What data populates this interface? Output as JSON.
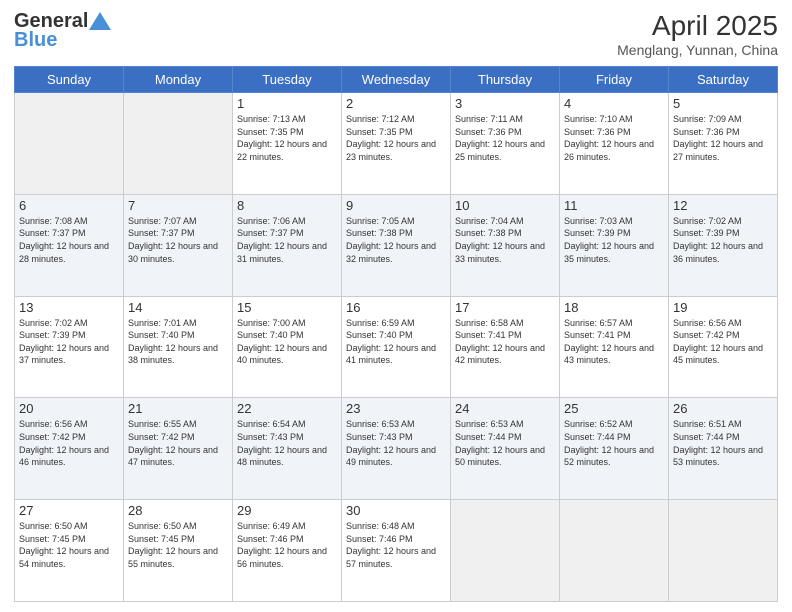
{
  "header": {
    "logo_line1": "General",
    "logo_line2": "Blue",
    "month": "April 2025",
    "location": "Menglang, Yunnan, China"
  },
  "weekdays": [
    "Sunday",
    "Monday",
    "Tuesday",
    "Wednesday",
    "Thursday",
    "Friday",
    "Saturday"
  ],
  "weeks": [
    [
      {
        "day": "",
        "sunrise": "",
        "sunset": "",
        "daylight": ""
      },
      {
        "day": "",
        "sunrise": "",
        "sunset": "",
        "daylight": ""
      },
      {
        "day": "1",
        "sunrise": "Sunrise: 7:13 AM",
        "sunset": "Sunset: 7:35 PM",
        "daylight": "Daylight: 12 hours and 22 minutes."
      },
      {
        "day": "2",
        "sunrise": "Sunrise: 7:12 AM",
        "sunset": "Sunset: 7:35 PM",
        "daylight": "Daylight: 12 hours and 23 minutes."
      },
      {
        "day": "3",
        "sunrise": "Sunrise: 7:11 AM",
        "sunset": "Sunset: 7:36 PM",
        "daylight": "Daylight: 12 hours and 25 minutes."
      },
      {
        "day": "4",
        "sunrise": "Sunrise: 7:10 AM",
        "sunset": "Sunset: 7:36 PM",
        "daylight": "Daylight: 12 hours and 26 minutes."
      },
      {
        "day": "5",
        "sunrise": "Sunrise: 7:09 AM",
        "sunset": "Sunset: 7:36 PM",
        "daylight": "Daylight: 12 hours and 27 minutes."
      }
    ],
    [
      {
        "day": "6",
        "sunrise": "Sunrise: 7:08 AM",
        "sunset": "Sunset: 7:37 PM",
        "daylight": "Daylight: 12 hours and 28 minutes."
      },
      {
        "day": "7",
        "sunrise": "Sunrise: 7:07 AM",
        "sunset": "Sunset: 7:37 PM",
        "daylight": "Daylight: 12 hours and 30 minutes."
      },
      {
        "day": "8",
        "sunrise": "Sunrise: 7:06 AM",
        "sunset": "Sunset: 7:37 PM",
        "daylight": "Daylight: 12 hours and 31 minutes."
      },
      {
        "day": "9",
        "sunrise": "Sunrise: 7:05 AM",
        "sunset": "Sunset: 7:38 PM",
        "daylight": "Daylight: 12 hours and 32 minutes."
      },
      {
        "day": "10",
        "sunrise": "Sunrise: 7:04 AM",
        "sunset": "Sunset: 7:38 PM",
        "daylight": "Daylight: 12 hours and 33 minutes."
      },
      {
        "day": "11",
        "sunrise": "Sunrise: 7:03 AM",
        "sunset": "Sunset: 7:39 PM",
        "daylight": "Daylight: 12 hours and 35 minutes."
      },
      {
        "day": "12",
        "sunrise": "Sunrise: 7:02 AM",
        "sunset": "Sunset: 7:39 PM",
        "daylight": "Daylight: 12 hours and 36 minutes."
      }
    ],
    [
      {
        "day": "13",
        "sunrise": "Sunrise: 7:02 AM",
        "sunset": "Sunset: 7:39 PM",
        "daylight": "Daylight: 12 hours and 37 minutes."
      },
      {
        "day": "14",
        "sunrise": "Sunrise: 7:01 AM",
        "sunset": "Sunset: 7:40 PM",
        "daylight": "Daylight: 12 hours and 38 minutes."
      },
      {
        "day": "15",
        "sunrise": "Sunrise: 7:00 AM",
        "sunset": "Sunset: 7:40 PM",
        "daylight": "Daylight: 12 hours and 40 minutes."
      },
      {
        "day": "16",
        "sunrise": "Sunrise: 6:59 AM",
        "sunset": "Sunset: 7:40 PM",
        "daylight": "Daylight: 12 hours and 41 minutes."
      },
      {
        "day": "17",
        "sunrise": "Sunrise: 6:58 AM",
        "sunset": "Sunset: 7:41 PM",
        "daylight": "Daylight: 12 hours and 42 minutes."
      },
      {
        "day": "18",
        "sunrise": "Sunrise: 6:57 AM",
        "sunset": "Sunset: 7:41 PM",
        "daylight": "Daylight: 12 hours and 43 minutes."
      },
      {
        "day": "19",
        "sunrise": "Sunrise: 6:56 AM",
        "sunset": "Sunset: 7:42 PM",
        "daylight": "Daylight: 12 hours and 45 minutes."
      }
    ],
    [
      {
        "day": "20",
        "sunrise": "Sunrise: 6:56 AM",
        "sunset": "Sunset: 7:42 PM",
        "daylight": "Daylight: 12 hours and 46 minutes."
      },
      {
        "day": "21",
        "sunrise": "Sunrise: 6:55 AM",
        "sunset": "Sunset: 7:42 PM",
        "daylight": "Daylight: 12 hours and 47 minutes."
      },
      {
        "day": "22",
        "sunrise": "Sunrise: 6:54 AM",
        "sunset": "Sunset: 7:43 PM",
        "daylight": "Daylight: 12 hours and 48 minutes."
      },
      {
        "day": "23",
        "sunrise": "Sunrise: 6:53 AM",
        "sunset": "Sunset: 7:43 PM",
        "daylight": "Daylight: 12 hours and 49 minutes."
      },
      {
        "day": "24",
        "sunrise": "Sunrise: 6:53 AM",
        "sunset": "Sunset: 7:44 PM",
        "daylight": "Daylight: 12 hours and 50 minutes."
      },
      {
        "day": "25",
        "sunrise": "Sunrise: 6:52 AM",
        "sunset": "Sunset: 7:44 PM",
        "daylight": "Daylight: 12 hours and 52 minutes."
      },
      {
        "day": "26",
        "sunrise": "Sunrise: 6:51 AM",
        "sunset": "Sunset: 7:44 PM",
        "daylight": "Daylight: 12 hours and 53 minutes."
      }
    ],
    [
      {
        "day": "27",
        "sunrise": "Sunrise: 6:50 AM",
        "sunset": "Sunset: 7:45 PM",
        "daylight": "Daylight: 12 hours and 54 minutes."
      },
      {
        "day": "28",
        "sunrise": "Sunrise: 6:50 AM",
        "sunset": "Sunset: 7:45 PM",
        "daylight": "Daylight: 12 hours and 55 minutes."
      },
      {
        "day": "29",
        "sunrise": "Sunrise: 6:49 AM",
        "sunset": "Sunset: 7:46 PM",
        "daylight": "Daylight: 12 hours and 56 minutes."
      },
      {
        "day": "30",
        "sunrise": "Sunrise: 6:48 AM",
        "sunset": "Sunset: 7:46 PM",
        "daylight": "Daylight: 12 hours and 57 minutes."
      },
      {
        "day": "",
        "sunrise": "",
        "sunset": "",
        "daylight": ""
      },
      {
        "day": "",
        "sunrise": "",
        "sunset": "",
        "daylight": ""
      },
      {
        "day": "",
        "sunrise": "",
        "sunset": "",
        "daylight": ""
      }
    ]
  ]
}
